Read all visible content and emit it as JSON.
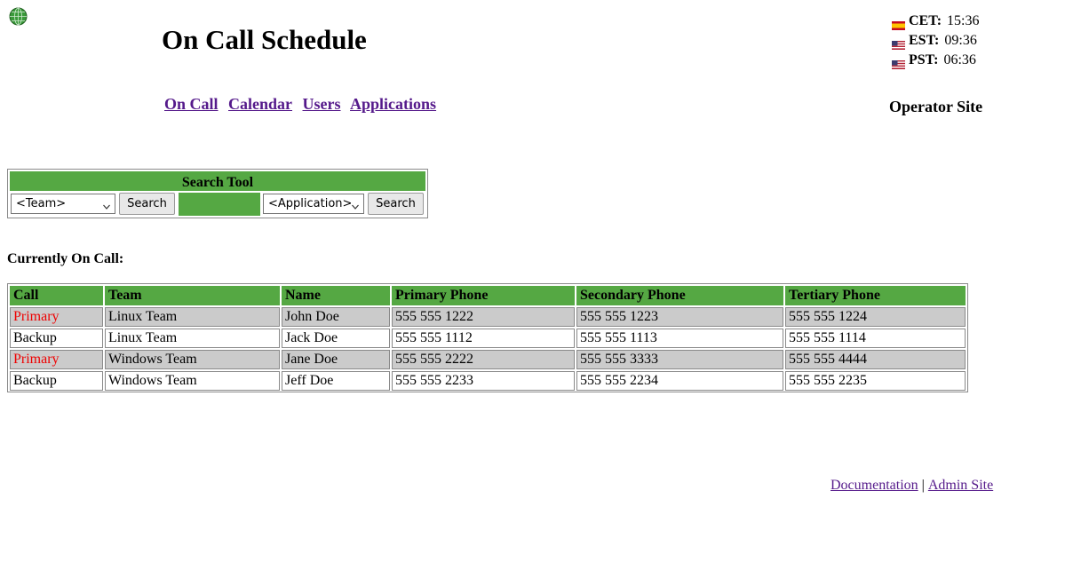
{
  "header": {
    "title": "On Call Schedule"
  },
  "nav": {
    "items": [
      "On Call",
      "Calendar",
      "Users",
      "Applications"
    ]
  },
  "clocks": [
    {
      "zone": "CET:",
      "time": "15:36",
      "flag": "spain-flag-icon"
    },
    {
      "zone": "EST:",
      "time": "09:36",
      "flag": "usa-flag-icon"
    },
    {
      "zone": "PST:",
      "time": "06:36",
      "flag": "usa-flag-icon"
    }
  ],
  "operator_site": "Operator Site",
  "search_tool": {
    "title": "Search Tool",
    "team_select": "<Team>",
    "team_button": "Search",
    "application_select": "<Application>",
    "application_button": "Search"
  },
  "on_call": {
    "label": "Currently On Call:",
    "columns": [
      "Call",
      "Team",
      "Name",
      "Primary Phone",
      "Secondary Phone",
      "Tertiary Phone"
    ],
    "rows": [
      [
        "Primary",
        "Linux Team",
        "John Doe",
        "555 555 1222",
        "555 555 1223",
        "555 555 1224"
      ],
      [
        "Backup",
        "Linux Team",
        "Jack Doe",
        "555 555 1112",
        "555 555 1113",
        "555 555 1114"
      ],
      [
        "Primary",
        "Windows Team",
        "Jane Doe",
        "555 555 2222",
        "555 555 3333",
        "555 555 4444"
      ],
      [
        "Backup",
        "Windows Team",
        "Jeff Doe",
        "555 555 2233",
        "555 555 2234",
        "555 555 2235"
      ]
    ]
  },
  "footer": {
    "documentation": "Documentation",
    "separator": "|",
    "admin_site": "Admin Site"
  },
  "colors": {
    "header_green": "#55a843",
    "row_grey": "#cbcbcb",
    "primary_red": "#ee0000",
    "link_purple": "#551a8b"
  }
}
